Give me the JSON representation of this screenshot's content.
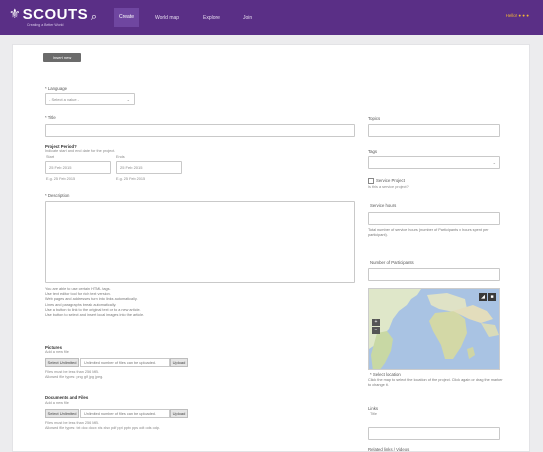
{
  "nav": {
    "logo_text": "SCOUTS",
    "logo_tagline": "Creating a Better World",
    "tabs": [
      {
        "label": "Create"
      },
      {
        "label": "World map"
      },
      {
        "label": "Explore"
      },
      {
        "label": "Join"
      }
    ],
    "user_text": "Hello! ● ● ● "
  },
  "toolbar": {
    "button_label": "Insert new"
  },
  "form": {
    "language": {
      "label": "* Language",
      "value": "- Select a value -"
    },
    "title": {
      "label": "* Title"
    },
    "project_period": {
      "label": "Project Period?",
      "hint": "Indicate start and end date for the project.",
      "start_label": "Start",
      "end_label": "Ends",
      "start_value": "25 Feb 2015",
      "end_value": "25 Feb 2015",
      "start_example": "E.g. 25 Feb 2015",
      "end_example": "E.g. 25 Feb 2015"
    },
    "description": {
      "label": "* Description"
    },
    "help_lines": [
      "You are able to use certain HTML tags.",
      "Use text editor tool for rich text version.",
      "Web pages and addresses turn into links automatically.",
      "Lines and paragraphs break automatically.",
      "Use a button to link to the original text or to a new article.",
      "Use button to select and insert local images into the article."
    ],
    "picture": {
      "label": "Pictures",
      "hint": "Add a new file",
      "file_button": "Select Unlimited",
      "file_text": "Unlimited number of files can be uploaded.",
      "upload_button": "Upload",
      "notes": [
        "Files must be less than 256 MB.",
        "Allowed file types: png gif jpg jpeg."
      ]
    },
    "documents": {
      "label": "Documents and Files",
      "hint": "Add a new file",
      "file_button": "Select Unlimited",
      "file_text": "Unlimited number of files can be uploaded.",
      "upload_button": "Upload",
      "notes": [
        "Files must be less than 256 MB.",
        "Allowed file types: txt doc docx xls xlsx pdf ppt pptx pps odt ods odp."
      ]
    },
    "topics": {
      "label": "Topics"
    },
    "tags": {
      "label": "Tags",
      "value": ""
    },
    "service": {
      "checkbox_label": "Service Project",
      "hint": "Is this a service project?",
      "hours_label": "Service hours",
      "hours_help": "Total number of service hours (number of Participants x hours spent per participant).",
      "participants_label": "Number of Participants"
    },
    "map": {
      "controls": [
        "◢",
        "■"
      ],
      "zoom": [
        "+",
        "−"
      ],
      "caption_label": "* Select location",
      "caption_help": "Click the map to select the location of the project. Click again or drag the marker to change it."
    },
    "links": {
      "label": "Links",
      "hint": "Title"
    },
    "bottom_label": "Related links / Videos"
  },
  "colors": {
    "brand": "#5a2f86",
    "accent": "#f1b733"
  }
}
